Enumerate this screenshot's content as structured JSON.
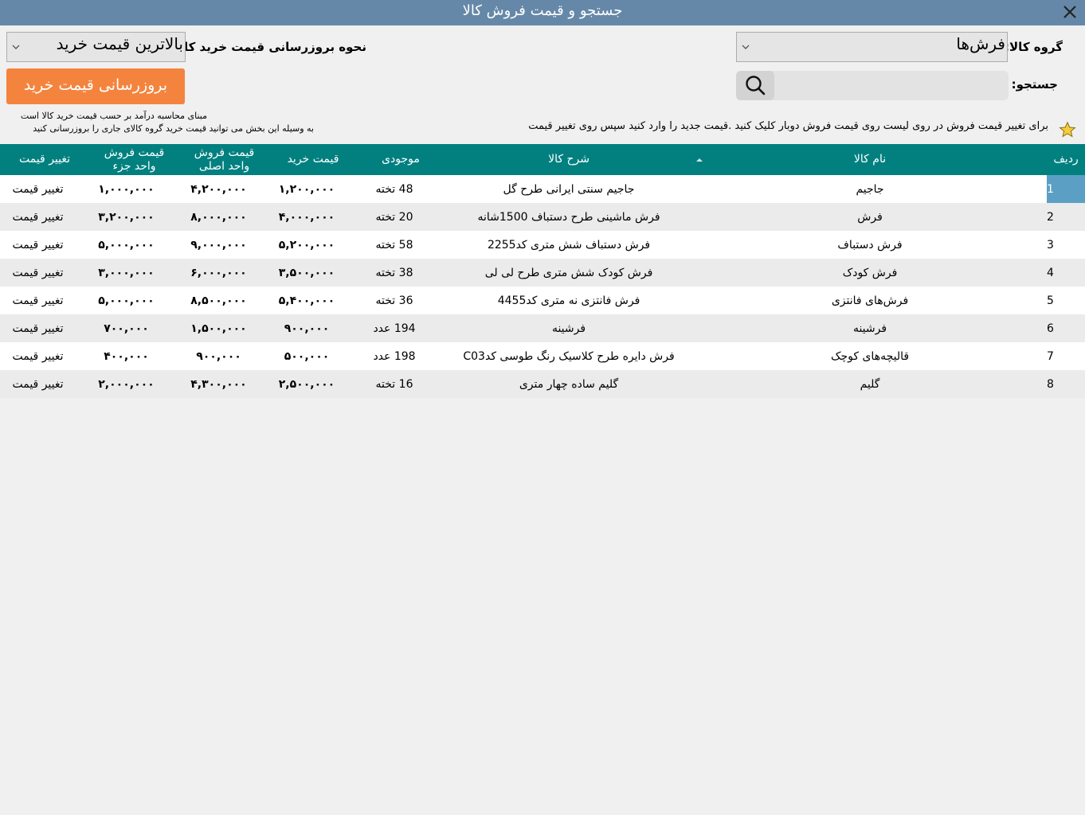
{
  "window": {
    "title": "جستجو و قیمت فروش کالا"
  },
  "filters": {
    "group_label": "گروه کالا:",
    "group_value": "فرش‌ها",
    "update_mode_label": "نحوه بروزرسانی قیمت خرید کالا :",
    "update_mode_value": "بالاترین قیمت خرید",
    "search_label": "جستجو:",
    "search_value": "",
    "update_button": "بروزرسانی قیمت خرید"
  },
  "info": {
    "basis_line": "مبنای محاسبه درآمد بر حسب قیمت خرید کالا است",
    "update_hint": "به وسیله این بخش می توانید قیمت خرید گروه کالای جاری را بروزرسانی کنید",
    "edit_hint": "برای تغییر قیمت فروش در روی لیست روی قیمت فروش دوبار کلیک کنید .قیمت جدید را وارد کنید سپس روی تغییر قیمت"
  },
  "table": {
    "headers": {
      "row": "ردیف",
      "name": "نام کالا",
      "desc": "شرح کالا",
      "stock": "موجودی",
      "buy": "قیمت خرید",
      "sell_main_1": "قیمت فروش",
      "sell_main_2": "واحد اصلی",
      "sell_part_1": "قیمت فروش",
      "sell_part_2": "واحد جزء",
      "change": "تغییر قیمت"
    },
    "rows": [
      {
        "n": "1",
        "name": "جاجیم",
        "desc": "جاجیم سنتی ایرانی طرح گل",
        "stock": "48 تخته",
        "buy": "۱,۲۰۰,۰۰۰",
        "sell_main": "۴,۲۰۰,۰۰۰",
        "sell_part": "۱,۰۰۰,۰۰۰",
        "action": "تغییر قیمت"
      },
      {
        "n": "2",
        "name": "فرش",
        "desc": "فرش ماشینی طرح دستباف 1500شانه",
        "stock": "20 تخته",
        "buy": "۴,۰۰۰,۰۰۰",
        "sell_main": "۸,۰۰۰,۰۰۰",
        "sell_part": "۳,۲۰۰,۰۰۰",
        "action": "تغییر قیمت"
      },
      {
        "n": "3",
        "name": "فرش دستباف",
        "desc": "فرش دستباف شش متری کد2255",
        "stock": "58 تخته",
        "buy": "۵,۲۰۰,۰۰۰",
        "sell_main": "۹,۰۰۰,۰۰۰",
        "sell_part": "۵,۰۰۰,۰۰۰",
        "action": "تغییر قیمت"
      },
      {
        "n": "4",
        "name": "فرش کودک",
        "desc": "فرش کودک شش متری طرح لی لی",
        "stock": "38 تخته",
        "buy": "۳,۵۰۰,۰۰۰",
        "sell_main": "۶,۰۰۰,۰۰۰",
        "sell_part": "۳,۰۰۰,۰۰۰",
        "action": "تغییر قیمت"
      },
      {
        "n": "5",
        "name": "فرش‌های فانتزی",
        "desc": "فرش فانتزی نه متری کد4455",
        "stock": "36 تخته",
        "buy": "۵,۴۰۰,۰۰۰",
        "sell_main": "۸,۵۰۰,۰۰۰",
        "sell_part": "۵,۰۰۰,۰۰۰",
        "action": "تغییر قیمت"
      },
      {
        "n": "6",
        "name": "فرشینه",
        "desc": "فرشینه",
        "stock": "194 عدد",
        "buy": "۹۰۰,۰۰۰",
        "sell_main": "۱,۵۰۰,۰۰۰",
        "sell_part": "۷۰۰,۰۰۰",
        "action": "تغییر قیمت"
      },
      {
        "n": "7",
        "name": "قالیچه‌های کوچک",
        "desc": "فرش دایره طرح کلاسیک رنگ طوسی کدC03",
        "stock": "198 عدد",
        "buy": "۵۰۰,۰۰۰",
        "sell_main": "۹۰۰,۰۰۰",
        "sell_part": "۴۰۰,۰۰۰",
        "action": "تغییر قیمت"
      },
      {
        "n": "8",
        "name": "گلیم",
        "desc": "گلیم ساده چهار متری",
        "stock": "16 تخته",
        "buy": "۲,۵۰۰,۰۰۰",
        "sell_main": "۴,۳۰۰,۰۰۰",
        "sell_part": "۲,۰۰۰,۰۰۰",
        "action": "تغییر قیمت"
      }
    ],
    "selected_row": 0
  },
  "icons": {
    "close": "close-icon",
    "search": "search-icon",
    "star": "star-icon",
    "chevron": "chevron-down-icon",
    "sort": "sort-asc-icon"
  },
  "colors": {
    "titlebar": "#6588a8",
    "header": "#028080",
    "accent_button": "#f4843d",
    "selected_row": "#5ba0c4"
  }
}
